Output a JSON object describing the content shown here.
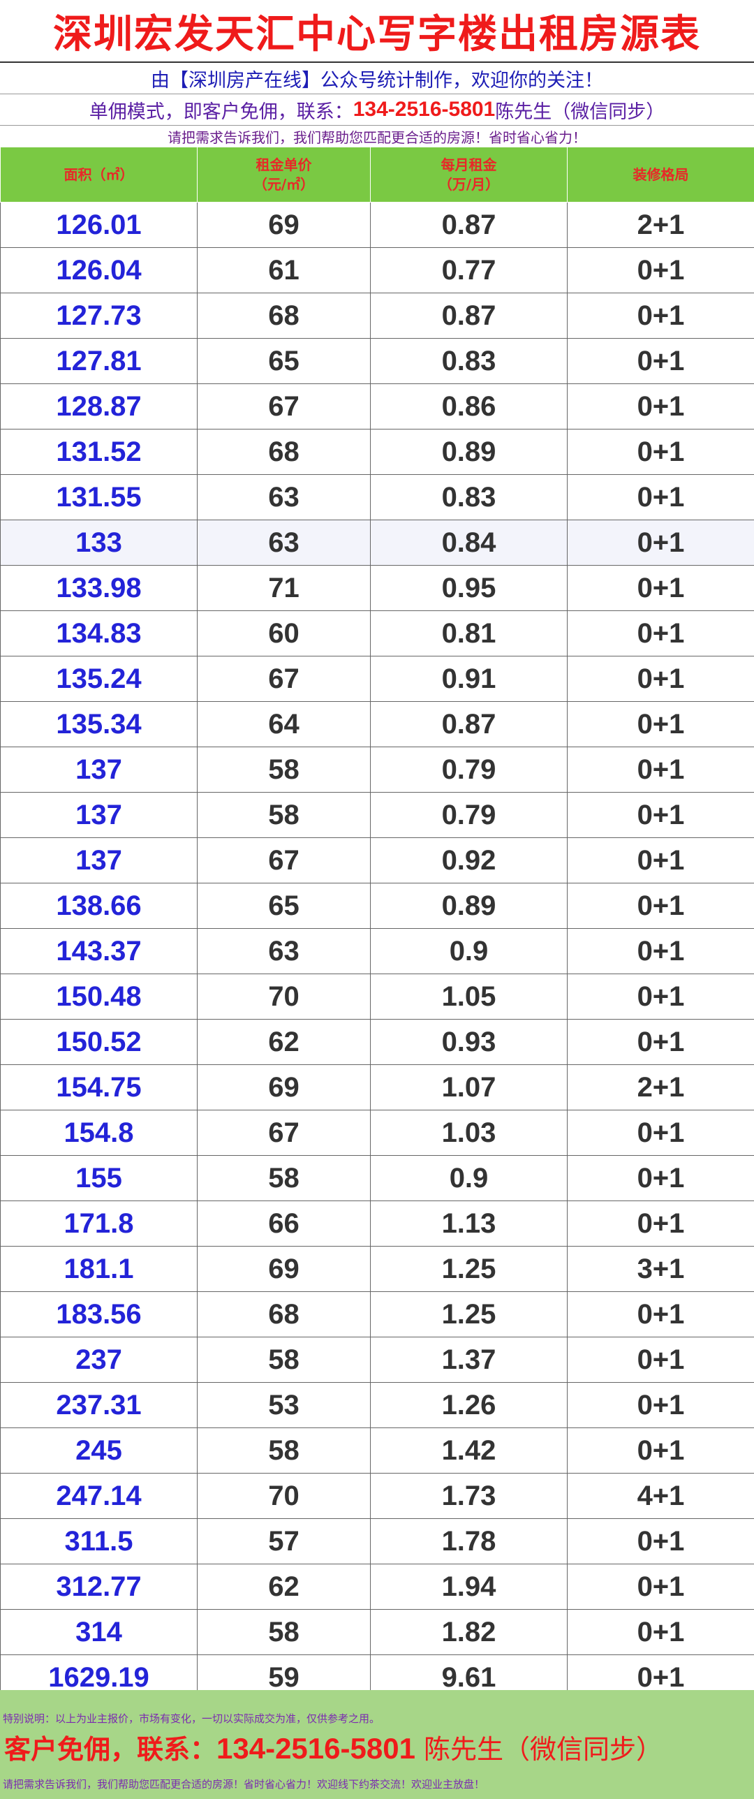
{
  "header": {
    "title": "深圳宏发天汇中心写字楼出租房源表",
    "subtitle1": "由【深圳房产在线】公众号统计制作，欢迎你的关注！",
    "subtitle2_prefix": "单佣模式，即客户免佣，联系：",
    "phone": "134-2516-5801",
    "subtitle2_suffix": " 陈先生（微信同步）",
    "subtitle3": "请把需求告诉我们，我们帮助您匹配更合适的房源！省时省心省力！"
  },
  "table": {
    "columns": [
      {
        "line1": "面积（㎡）",
        "line2": ""
      },
      {
        "line1": "租金单价",
        "line2": "（元/㎡）"
      },
      {
        "line1": "每月租金",
        "line2": "（万/月）"
      },
      {
        "line1": "装修格局",
        "line2": ""
      }
    ],
    "rows": [
      [
        "126.01",
        "69",
        "0.87",
        "2+1"
      ],
      [
        "126.04",
        "61",
        "0.77",
        "0+1"
      ],
      [
        "127.73",
        "68",
        "0.87",
        "0+1"
      ],
      [
        "127.81",
        "65",
        "0.83",
        "0+1"
      ],
      [
        "128.87",
        "67",
        "0.86",
        "0+1"
      ],
      [
        "131.52",
        "68",
        "0.89",
        "0+1"
      ],
      [
        "131.55",
        "63",
        "0.83",
        "0+1"
      ],
      [
        "133",
        "63",
        "0.84",
        "0+1"
      ],
      [
        "133.98",
        "71",
        "0.95",
        "0+1"
      ],
      [
        "134.83",
        "60",
        "0.81",
        "0+1"
      ],
      [
        "135.24",
        "67",
        "0.91",
        "0+1"
      ],
      [
        "135.34",
        "64",
        "0.87",
        "0+1"
      ],
      [
        "137",
        "58",
        "0.79",
        "0+1"
      ],
      [
        "137",
        "58",
        "0.79",
        "0+1"
      ],
      [
        "137",
        "67",
        "0.92",
        "0+1"
      ],
      [
        "138.66",
        "65",
        "0.89",
        "0+1"
      ],
      [
        "143.37",
        "63",
        "0.9",
        "0+1"
      ],
      [
        "150.48",
        "70",
        "1.05",
        "0+1"
      ],
      [
        "150.52",
        "62",
        "0.93",
        "0+1"
      ],
      [
        "154.75",
        "69",
        "1.07",
        "2+1"
      ],
      [
        "154.8",
        "67",
        "1.03",
        "0+1"
      ],
      [
        "155",
        "58",
        "0.9",
        "0+1"
      ],
      [
        "171.8",
        "66",
        "1.13",
        "0+1"
      ],
      [
        "181.1",
        "69",
        "1.25",
        "3+1"
      ],
      [
        "183.56",
        "68",
        "1.25",
        "0+1"
      ],
      [
        "237",
        "58",
        "1.37",
        "0+1"
      ],
      [
        "237.31",
        "53",
        "1.26",
        "0+1"
      ],
      [
        "245",
        "58",
        "1.42",
        "0+1"
      ],
      [
        "247.14",
        "70",
        "1.73",
        "4+1"
      ],
      [
        "311.5",
        "57",
        "1.78",
        "0+1"
      ],
      [
        "312.77",
        "62",
        "1.94",
        "0+1"
      ],
      [
        "314",
        "58",
        "1.82",
        "0+1"
      ],
      [
        "1629.19",
        "59",
        "9.61",
        "0+1"
      ]
    ]
  },
  "footer": {
    "note": "特别说明：以上为业主报价，市场有变化，一切以实际成交为准，仅供参考之用。",
    "contact_prefix": "客户免佣，联系：",
    "phone": "134-2516-5801",
    "contact_suffix": " 陈先生（微信同步）",
    "bottom_line": "请把需求告诉我们，我们帮助您匹配更合适的房源！省时省心省力！欢迎线下约茶交流！欢迎业主放盘！"
  },
  "colors": {
    "title_red": "#ef1b1b",
    "area_blue": "#2323d8",
    "header_green": "#7ac943",
    "footer_green": "#a7d688",
    "highlight_row": "#f3f4fb"
  }
}
